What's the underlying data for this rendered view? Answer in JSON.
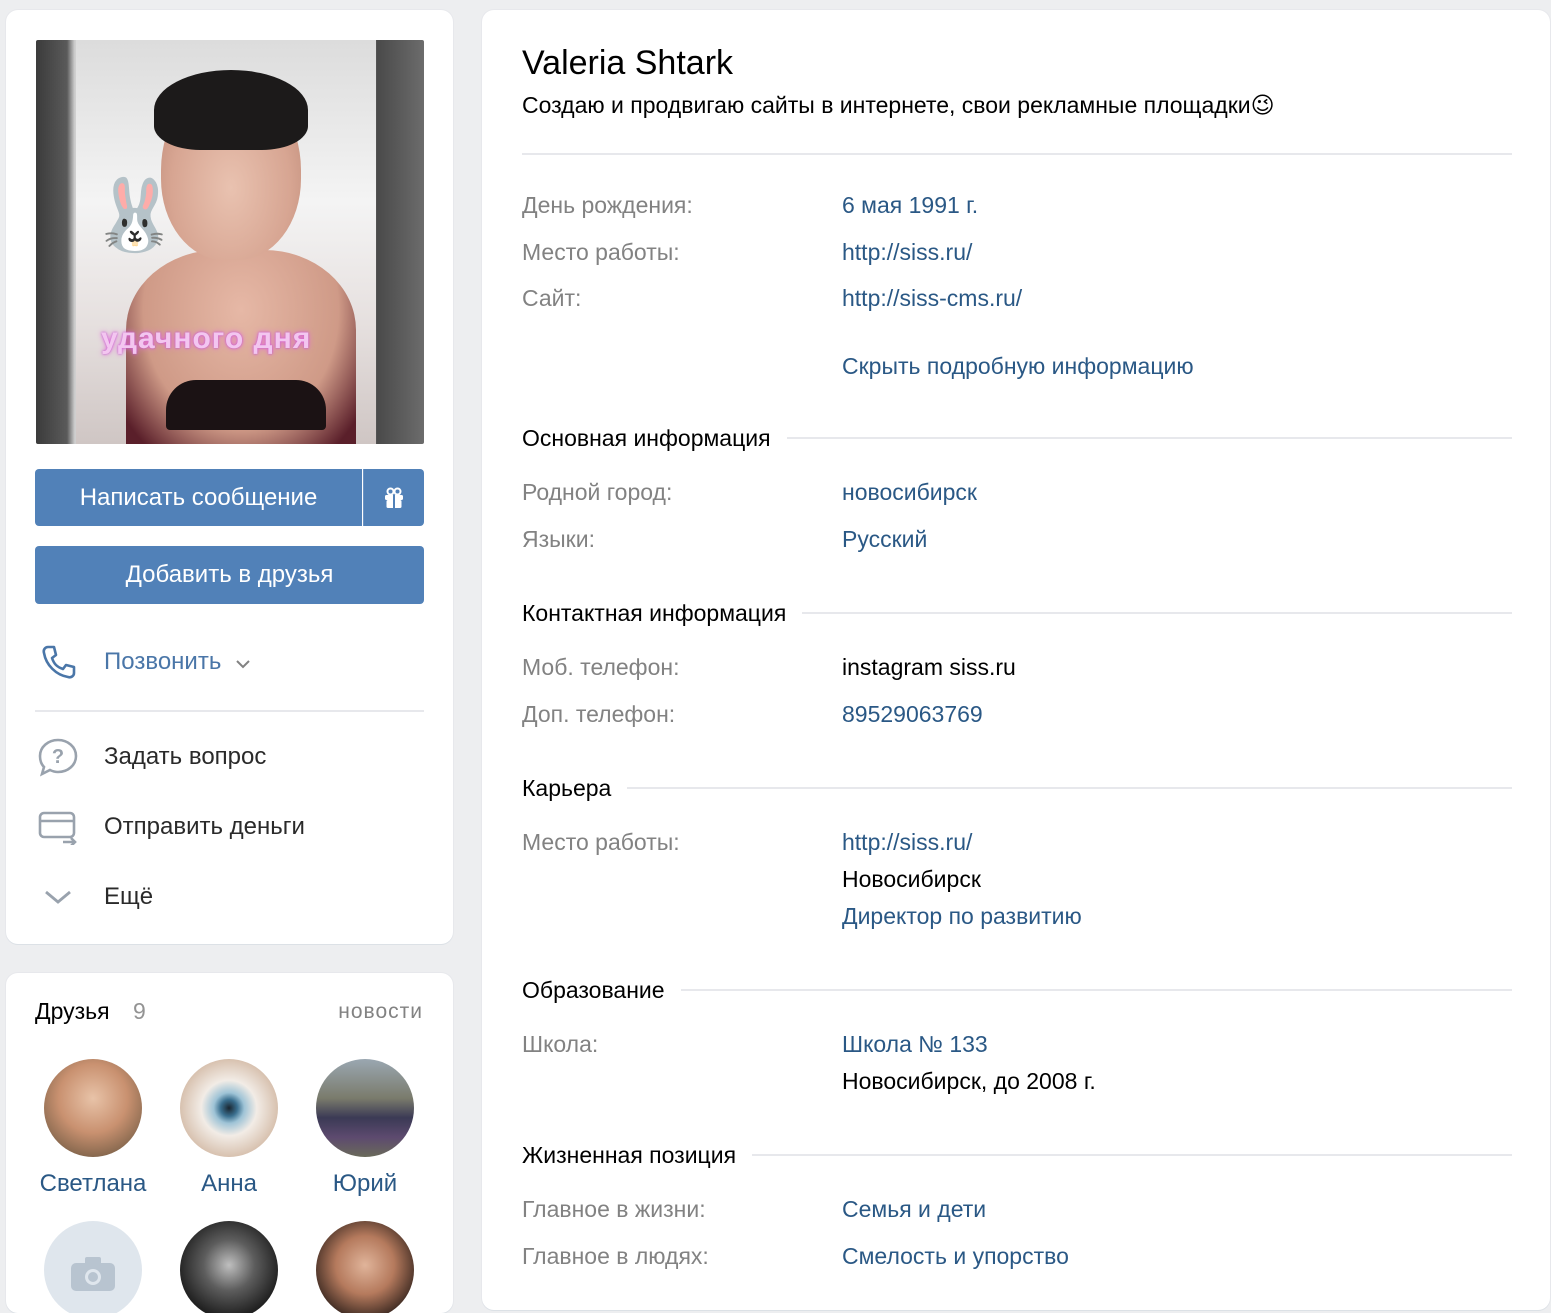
{
  "profile": {
    "name": "Valeria Shtark",
    "status": "Создаю и продвигаю сайты в интернете, свои рекламные площадки",
    "status_emoji": "😉",
    "avatar_caption": "удачного  дня"
  },
  "actions": {
    "message": "Написать сообщение",
    "add_friend": "Добавить в друзья",
    "call": "Позвонить",
    "ask": "Задать вопрос",
    "send_money": "Отправить деньги",
    "more": "Ещё"
  },
  "friends": {
    "title": "Друзья",
    "count": "9",
    "news": "новости",
    "items": [
      {
        "name": "Светлана"
      },
      {
        "name": "Анна"
      },
      {
        "name": "Юрий"
      },
      {
        "name": ""
      },
      {
        "name": ""
      },
      {
        "name": ""
      }
    ]
  },
  "info": {
    "birthday_label": "День рождения:",
    "birthday_value": "6 мая 1991 г.",
    "work_label": "Место работы:",
    "work_value": "http://siss.ru/",
    "site_label": "Сайт:",
    "site_value": "http://siss-cms.ru/",
    "hide_details": "Скрыть подробную информацию"
  },
  "sections": {
    "basic": {
      "title": "Основная информация",
      "hometown_label": "Родной город:",
      "hometown_value": "новосибирск",
      "languages_label": "Языки:",
      "languages_value": "Русский"
    },
    "contacts": {
      "title": "Контактная информация",
      "mobile_label": "Моб. телефон:",
      "mobile_value": "instagram siss.ru",
      "extra_label": "Доп. телефон:",
      "extra_value": "89529063769"
    },
    "career": {
      "title": "Карьера",
      "work_label": "Место работы:",
      "work_value": "http://siss.ru/",
      "city": "Новосибирск",
      "position": "Директор по развитию"
    },
    "education": {
      "title": "Образование",
      "school_label": "Школа:",
      "school_value": "Школа № 133",
      "school_detail": "Новосибирск, до 2008 г."
    },
    "life": {
      "title": "Жизненная позиция",
      "main_life_label": "Главное в жизни:",
      "main_life_value": "Семья и дети",
      "main_people_label": "Главное в людях:",
      "main_people_value": "Смелость и упорство"
    }
  },
  "colors": {
    "accent": "#5181b8",
    "link": "#2a5885",
    "label": "#828282",
    "background": "#edeef0"
  }
}
